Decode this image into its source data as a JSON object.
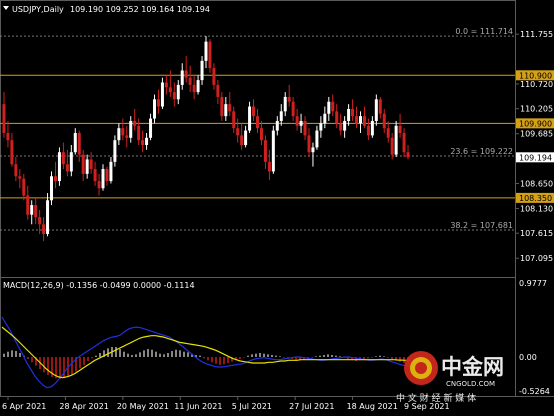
{
  "header": {
    "title": "USDJPY,Daily",
    "ohlc": "109.190 109.252 109.164 109.194",
    "menu_icon": "triangle-down-icon"
  },
  "price_axis": {
    "ticks": [
      "111.755",
      "110.720",
      "110.205",
      "109.685",
      "109.165",
      "108.650",
      "108.130",
      "107.615",
      "107.095"
    ],
    "current_price": "109.194"
  },
  "levels": {
    "resistance_high": "110.900",
    "resistance_low": "109.900",
    "support": "108.350",
    "colors": {
      "level_line": "#d4a017",
      "fib_line": "#777777",
      "current_price_bg": "#ffffff"
    }
  },
  "fibonacci": [
    {
      "label": "0.0 = 111.714",
      "value": 111.714
    },
    {
      "label": "23.6 = 109.222",
      "value": 109.222
    },
    {
      "label": "38.2 = 107.681",
      "value": 107.681
    }
  ],
  "macd": {
    "title": "MACD(12,26,9) -0.1356 -0.0499 0.0000 -0.1114",
    "ticks": [
      "0.9777",
      "0.00",
      "-0.5264"
    ],
    "colors": {
      "main_histogram": "#c0c0c0",
      "negative_histogram": "#d62020",
      "signal_line": "#e6e200",
      "main_line": "#2030e0"
    }
  },
  "time_axis": {
    "labels": [
      "6 Apr 2021",
      "28 Apr 2021",
      "20 May 2021",
      "11 Jun 2021",
      "5 Jul 2021",
      "27 Jul 2021",
      "18 Aug 2021",
      "9 Sep 2021"
    ]
  },
  "watermark": {
    "brand_cn": "中金网",
    "brand_url": "CNGOLD.COM",
    "tagline_cn": "中 文 财 经 新 媒 体"
  },
  "chart_data": {
    "type": "candlestick",
    "symbol": "USDJPY",
    "timeframe": "Daily",
    "candle_colors": {
      "bull": "#ffffff",
      "bear": "#d02020"
    },
    "price_range": [
      106.85,
      112.05
    ],
    "candles": [
      [
        110.3,
        110.55,
        109.6,
        109.7
      ],
      [
        109.7,
        109.95,
        109.4,
        109.55
      ],
      [
        109.55,
        109.7,
        109.0,
        109.05
      ],
      [
        109.05,
        109.2,
        108.7,
        108.8
      ],
      [
        108.8,
        108.95,
        108.55,
        108.75
      ],
      [
        108.75,
        108.85,
        108.3,
        108.4
      ],
      [
        108.4,
        108.6,
        107.9,
        108.0
      ],
      [
        108.0,
        108.3,
        107.8,
        108.2
      ],
      [
        108.2,
        108.35,
        107.8,
        107.95
      ],
      [
        107.95,
        108.1,
        107.6,
        107.8
      ],
      [
        107.8,
        107.95,
        107.45,
        107.6
      ],
      [
        107.6,
        108.45,
        107.55,
        108.3
      ],
      [
        108.3,
        108.9,
        108.2,
        108.8
      ],
      [
        108.8,
        109.1,
        108.55,
        108.7
      ],
      [
        108.7,
        109.4,
        108.6,
        109.3
      ],
      [
        109.3,
        109.5,
        108.95,
        109.05
      ],
      [
        109.05,
        109.35,
        108.8,
        108.9
      ],
      [
        108.9,
        109.45,
        108.8,
        109.3
      ],
      [
        109.3,
        109.8,
        109.25,
        109.7
      ],
      [
        109.7,
        109.75,
        109.1,
        109.25
      ],
      [
        109.25,
        109.35,
        108.7,
        108.85
      ],
      [
        108.85,
        109.25,
        108.75,
        109.15
      ],
      [
        109.15,
        109.3,
        108.85,
        108.95
      ],
      [
        108.95,
        109.1,
        108.6,
        108.7
      ],
      [
        108.7,
        108.85,
        108.4,
        108.55
      ],
      [
        108.55,
        109.05,
        108.5,
        108.95
      ],
      [
        108.95,
        109.0,
        108.6,
        108.7
      ],
      [
        108.7,
        109.2,
        108.65,
        109.1
      ],
      [
        109.1,
        109.65,
        109.0,
        109.55
      ],
      [
        109.55,
        109.9,
        109.45,
        109.8
      ],
      [
        109.8,
        110.0,
        109.55,
        109.65
      ],
      [
        109.65,
        109.85,
        109.4,
        109.6
      ],
      [
        109.6,
        110.05,
        109.5,
        109.95
      ],
      [
        109.95,
        110.2,
        109.75,
        109.85
      ],
      [
        109.85,
        110.0,
        109.45,
        109.55
      ],
      [
        109.55,
        109.75,
        109.3,
        109.45
      ],
      [
        109.45,
        109.7,
        109.35,
        109.6
      ],
      [
        109.6,
        110.1,
        109.55,
        110.0
      ],
      [
        110.0,
        110.5,
        109.9,
        110.4
      ],
      [
        110.4,
        110.6,
        110.1,
        110.25
      ],
      [
        110.25,
        110.85,
        110.2,
        110.75
      ],
      [
        110.75,
        110.9,
        110.5,
        110.65
      ],
      [
        110.65,
        111.0,
        110.45,
        110.55
      ],
      [
        110.55,
        110.75,
        110.25,
        110.4
      ],
      [
        110.4,
        110.8,
        110.3,
        110.7
      ],
      [
        110.7,
        111.15,
        110.6,
        111.0
      ],
      [
        111.0,
        111.3,
        110.75,
        110.85
      ],
      [
        110.85,
        111.1,
        110.55,
        110.7
      ],
      [
        110.7,
        110.9,
        110.4,
        110.55
      ],
      [
        110.55,
        110.9,
        110.5,
        110.8
      ],
      [
        110.8,
        111.3,
        110.7,
        111.2
      ],
      [
        111.2,
        111.714,
        111.05,
        111.6
      ],
      [
        111.6,
        111.65,
        110.95,
        111.05
      ],
      [
        111.05,
        111.15,
        110.6,
        110.7
      ],
      [
        110.7,
        110.8,
        110.3,
        110.45
      ],
      [
        110.45,
        110.55,
        109.95,
        110.05
      ],
      [
        110.05,
        110.45,
        109.95,
        110.3
      ],
      [
        110.3,
        110.55,
        110.05,
        110.15
      ],
      [
        110.15,
        110.25,
        109.7,
        109.8
      ],
      [
        109.8,
        110.0,
        109.5,
        109.65
      ],
      [
        109.65,
        109.9,
        109.35,
        109.45
      ],
      [
        109.45,
        109.85,
        109.4,
        109.75
      ],
      [
        109.75,
        110.35,
        109.7,
        110.25
      ],
      [
        110.25,
        110.4,
        109.95,
        110.05
      ],
      [
        110.05,
        110.2,
        109.7,
        109.8
      ],
      [
        109.8,
        109.95,
        109.45,
        109.55
      ],
      [
        109.55,
        109.65,
        108.95,
        109.1
      ],
      [
        109.1,
        109.35,
        108.72,
        108.9
      ],
      [
        108.9,
        109.85,
        108.85,
        109.75
      ],
      [
        109.75,
        110.05,
        109.65,
        109.95
      ],
      [
        109.95,
        110.3,
        109.85,
        110.15
      ],
      [
        110.15,
        110.55,
        110.05,
        110.45
      ],
      [
        110.45,
        110.7,
        110.25,
        110.35
      ],
      [
        110.35,
        110.45,
        109.95,
        110.05
      ],
      [
        110.05,
        110.2,
        109.75,
        109.85
      ],
      [
        109.85,
        110.1,
        109.7,
        109.95
      ],
      [
        109.95,
        110.05,
        109.55,
        109.65
      ],
      [
        109.65,
        109.8,
        109.2,
        109.3
      ],
      [
        109.3,
        109.5,
        109.0,
        109.4
      ],
      [
        109.4,
        109.85,
        109.35,
        109.75
      ],
      [
        109.75,
        110.05,
        109.6,
        109.9
      ],
      [
        109.9,
        110.25,
        109.8,
        110.1
      ],
      [
        110.1,
        110.45,
        109.95,
        110.35
      ],
      [
        110.35,
        110.5,
        110.05,
        110.15
      ],
      [
        110.15,
        110.3,
        109.8,
        109.9
      ],
      [
        109.9,
        110.1,
        109.65,
        109.75
      ],
      [
        109.75,
        110.05,
        109.6,
        109.95
      ],
      [
        109.95,
        110.3,
        109.85,
        110.2
      ],
      [
        110.2,
        110.4,
        109.95,
        110.05
      ],
      [
        110.05,
        110.25,
        109.8,
        109.9
      ],
      [
        109.9,
        110.15,
        109.7,
        110.05
      ],
      [
        110.05,
        110.25,
        109.8,
        109.85
      ],
      [
        109.85,
        110.0,
        109.55,
        109.65
      ],
      [
        109.65,
        110.05,
        109.6,
        109.95
      ],
      [
        109.95,
        110.5,
        109.85,
        110.4
      ],
      [
        110.4,
        110.45,
        110.0,
        110.1
      ],
      [
        110.1,
        110.2,
        109.7,
        109.8
      ],
      [
        109.8,
        109.95,
        109.5,
        109.6
      ],
      [
        109.6,
        109.7,
        109.15,
        109.25
      ],
      [
        109.25,
        109.95,
        109.2,
        109.85
      ],
      [
        109.85,
        110.1,
        109.6,
        109.7
      ],
      [
        109.7,
        109.8,
        109.2,
        109.3
      ],
      [
        109.3,
        109.45,
        109.15,
        109.194
      ]
    ],
    "macd_histogram": [
      0.05,
      0.08,
      0.1,
      0.09,
      0.06,
      0.02,
      -0.03,
      -0.08,
      -0.13,
      -0.18,
      -0.23,
      -0.27,
      -0.3,
      -0.32,
      -0.33,
      -0.32,
      -0.3,
      -0.27,
      -0.22,
      -0.17,
      -0.12,
      -0.06,
      -0.02,
      0.02,
      0.06,
      0.1,
      0.13,
      0.15,
      0.15,
      0.12,
      0.08,
      0.05,
      0.03,
      0.04,
      0.07,
      0.1,
      0.12,
      0.11,
      0.08,
      0.05,
      0.04,
      0.06,
      0.09,
      0.11,
      0.1,
      0.08,
      0.07,
      0.05,
      0.03,
      0.02,
      -0.02,
      -0.05,
      -0.08,
      -0.1,
      -0.12,
      -0.11,
      -0.09,
      -0.07,
      -0.05,
      -0.03,
      -0.01,
      0.02,
      0.04,
      0.05,
      0.06,
      0.05,
      0.04,
      0.03,
      0.02,
      0.01,
      -0.01,
      -0.02,
      -0.03,
      -0.04,
      -0.05,
      -0.04,
      -0.03,
      -0.01,
      0.01,
      0.02,
      0.03,
      0.04,
      0.03,
      0.02,
      0.01,
      -0.01,
      -0.03,
      -0.05,
      -0.06,
      -0.05,
      -0.04,
      -0.02,
      -0.01,
      0.01,
      0.02,
      0.01,
      -0.01,
      -0.03,
      -0.05,
      -0.07,
      -0.09,
      -0.11
    ],
    "macd_signal": [
      0.45,
      0.4,
      0.35,
      0.3,
      0.24,
      0.18,
      0.12,
      0.06,
      0.0,
      -0.06,
      -0.12,
      -0.18,
      -0.23,
      -0.27,
      -0.3,
      -0.31,
      -0.3,
      -0.28,
      -0.25,
      -0.21,
      -0.17,
      -0.13,
      -0.09,
      -0.05,
      -0.02,
      0.01,
      0.04,
      0.07,
      0.1,
      0.13,
      0.16,
      0.19,
      0.22,
      0.25,
      0.28,
      0.3,
      0.31,
      0.32,
      0.32,
      0.31,
      0.3,
      0.28,
      0.26,
      0.24,
      0.22,
      0.21,
      0.2,
      0.19,
      0.18,
      0.17,
      0.16,
      0.14,
      0.12,
      0.1,
      0.07,
      0.04,
      0.01,
      -0.02,
      -0.04,
      -0.06,
      -0.07,
      -0.08,
      -0.09,
      -0.09,
      -0.09,
      -0.09,
      -0.08,
      -0.08,
      -0.07,
      -0.06,
      -0.06,
      -0.05,
      -0.05,
      -0.05,
      -0.04,
      -0.04,
      -0.04,
      -0.04,
      -0.04,
      -0.04,
      -0.04,
      -0.04,
      -0.04,
      -0.04,
      -0.04,
      -0.04,
      -0.04,
      -0.04,
      -0.04,
      -0.04,
      -0.04,
      -0.04,
      -0.04,
      -0.04,
      -0.04,
      -0.04,
      -0.04,
      -0.04,
      -0.045,
      -0.047,
      -0.049,
      -0.0499
    ],
    "macd_main": [
      0.6,
      0.5,
      0.4,
      0.28,
      0.16,
      0.05,
      -0.08,
      -0.18,
      -0.28,
      -0.36,
      -0.42,
      -0.46,
      -0.45,
      -0.4,
      -0.33,
      -0.25,
      -0.17,
      -0.1,
      -0.04,
      0.01,
      0.05,
      0.09,
      0.13,
      0.17,
      0.21,
      0.25,
      0.28,
      0.3,
      0.31,
      0.33,
      0.38,
      0.42,
      0.44,
      0.45,
      0.44,
      0.42,
      0.4,
      0.38,
      0.36,
      0.34,
      0.32,
      0.3,
      0.26,
      0.22,
      0.17,
      0.12,
      0.07,
      0.02,
      -0.03,
      -0.07,
      -0.1,
      -0.12,
      -0.14,
      -0.15,
      -0.15,
      -0.14,
      -0.13,
      -0.12,
      -0.11,
      -0.1,
      -0.08,
      -0.05,
      -0.03,
      -0.02,
      -0.01,
      -0.02,
      -0.03,
      -0.04,
      -0.04,
      -0.03,
      -0.02,
      -0.01,
      0.0,
      0.0,
      -0.01,
      -0.02,
      -0.03,
      -0.04,
      -0.05,
      -0.05,
      -0.04,
      -0.03,
      -0.02,
      -0.01,
      0.0,
      0.0,
      -0.01,
      -0.02,
      -0.03,
      -0.04,
      -0.05,
      -0.05,
      -0.04,
      -0.03,
      -0.04,
      -0.06,
      -0.08,
      -0.1,
      -0.12,
      -0.13,
      -0.1356
    ]
  }
}
